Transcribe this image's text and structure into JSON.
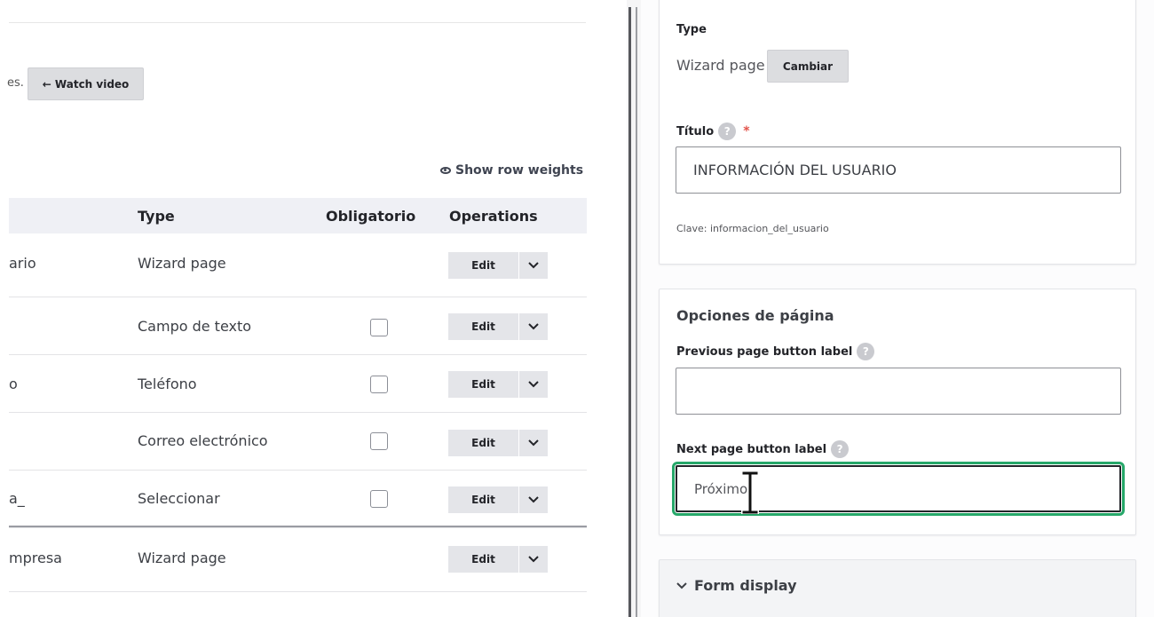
{
  "left": {
    "intro_tail": "es.",
    "watch_video": "← Watch video",
    "show_row_weights": "Show row weights",
    "headers": {
      "type": "Type",
      "required": "Obligatorio",
      "operations": "Operations"
    },
    "rows": [
      {
        "name": "ario",
        "type": "Wizard page",
        "has_checkbox": false,
        "edit": "Edit"
      },
      {
        "name": "",
        "type": "Campo de texto",
        "has_checkbox": true,
        "edit": "Edit"
      },
      {
        "name": "o",
        "type": "Teléfono",
        "has_checkbox": true,
        "edit": "Edit"
      },
      {
        "name": "",
        "type": "Correo electrónico",
        "has_checkbox": true,
        "edit": "Edit"
      },
      {
        "name": "a_",
        "type": "Seleccionar",
        "has_checkbox": true,
        "edit": "Edit"
      },
      {
        "name": "mpresa",
        "type": "Wizard page",
        "has_checkbox": false,
        "edit": "Edit"
      }
    ]
  },
  "right": {
    "type_label": "Type",
    "type_value": "Wizard page",
    "change_button": "Cambiar",
    "title_label": "Título",
    "title_required": "*",
    "title_value": "INFORMACIÓN DEL USUARIO",
    "machine_key": "Clave: informacion_del_usuario",
    "page_options_title": "Opciones de página",
    "prev_label": "Previous page button label",
    "prev_value": "",
    "next_label": "Next page button label",
    "next_value": "Próximo",
    "form_display": "Form display"
  },
  "colors": {
    "focus_outline": "#26a769",
    "header_bg": "#eff0f5",
    "button_bg": "#e4e5e9"
  }
}
